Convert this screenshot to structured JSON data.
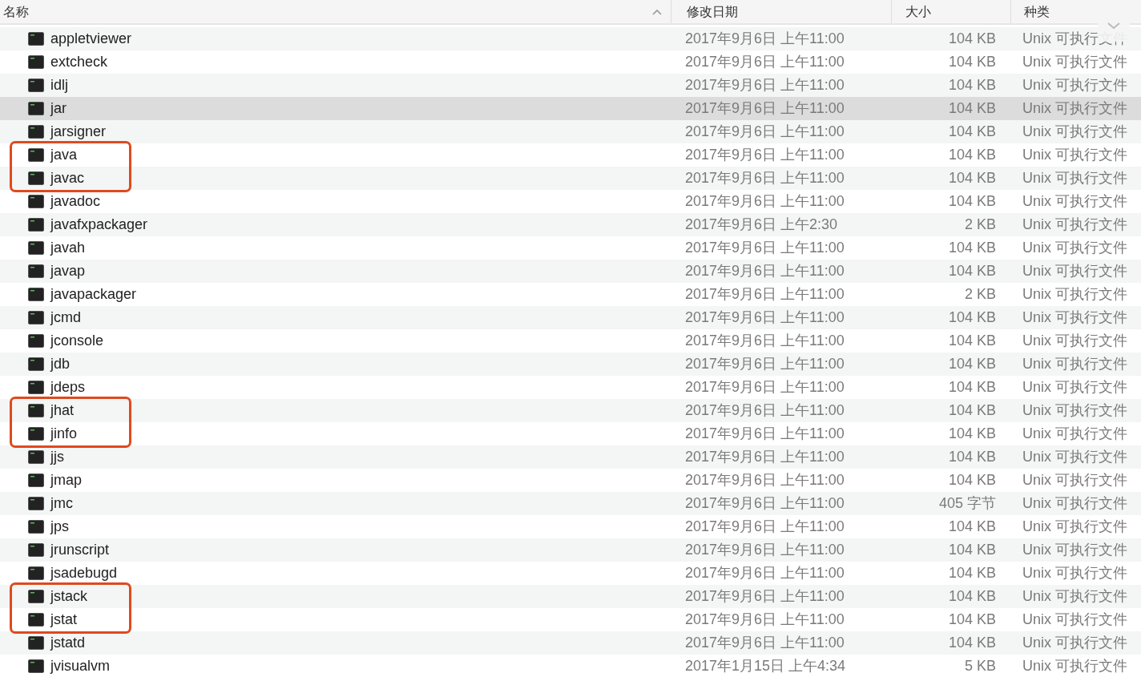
{
  "columns": [
    {
      "label": "名称",
      "sorted": true
    },
    {
      "label": "修改日期",
      "sorted": false
    },
    {
      "label": "大小",
      "sorted": false
    },
    {
      "label": "种类",
      "sorted": false
    }
  ],
  "rows": [
    {
      "name": "appletviewer",
      "date": "2017年9月6日 上午11:00",
      "size": "104 KB",
      "kind": "Unix 可执行文件",
      "selected": false,
      "circled": false
    },
    {
      "name": "extcheck",
      "date": "2017年9月6日 上午11:00",
      "size": "104 KB",
      "kind": "Unix 可执行文件",
      "selected": false,
      "circled": false
    },
    {
      "name": "idlj",
      "date": "2017年9月6日 上午11:00",
      "size": "104 KB",
      "kind": "Unix 可执行文件",
      "selected": false,
      "circled": false
    },
    {
      "name": "jar",
      "date": "2017年9月6日 上午11:00",
      "size": "104 KB",
      "kind": "Unix 可执行文件",
      "selected": true,
      "circled": false
    },
    {
      "name": "jarsigner",
      "date": "2017年9月6日 上午11:00",
      "size": "104 KB",
      "kind": "Unix 可执行文件",
      "selected": false,
      "circled": false
    },
    {
      "name": "java",
      "date": "2017年9月6日 上午11:00",
      "size": "104 KB",
      "kind": "Unix 可执行文件",
      "selected": false,
      "circled": true
    },
    {
      "name": "javac",
      "date": "2017年9月6日 上午11:00",
      "size": "104 KB",
      "kind": "Unix 可执行文件",
      "selected": false,
      "circled": true
    },
    {
      "name": "javadoc",
      "date": "2017年9月6日 上午11:00",
      "size": "104 KB",
      "kind": "Unix 可执行文件",
      "selected": false,
      "circled": false
    },
    {
      "name": "javafxpackager",
      "date": "2017年9月6日 上午2:30",
      "size": "2 KB",
      "kind": "Unix 可执行文件",
      "selected": false,
      "circled": false
    },
    {
      "name": "javah",
      "date": "2017年9月6日 上午11:00",
      "size": "104 KB",
      "kind": "Unix 可执行文件",
      "selected": false,
      "circled": false
    },
    {
      "name": "javap",
      "date": "2017年9月6日 上午11:00",
      "size": "104 KB",
      "kind": "Unix 可执行文件",
      "selected": false,
      "circled": false
    },
    {
      "name": "javapackager",
      "date": "2017年9月6日 上午11:00",
      "size": "2 KB",
      "kind": "Unix 可执行文件",
      "selected": false,
      "circled": false
    },
    {
      "name": "jcmd",
      "date": "2017年9月6日 上午11:00",
      "size": "104 KB",
      "kind": "Unix 可执行文件",
      "selected": false,
      "circled": false
    },
    {
      "name": "jconsole",
      "date": "2017年9月6日 上午11:00",
      "size": "104 KB",
      "kind": "Unix 可执行文件",
      "selected": false,
      "circled": false
    },
    {
      "name": "jdb",
      "date": "2017年9月6日 上午11:00",
      "size": "104 KB",
      "kind": "Unix 可执行文件",
      "selected": false,
      "circled": false
    },
    {
      "name": "jdeps",
      "date": "2017年9月6日 上午11:00",
      "size": "104 KB",
      "kind": "Unix 可执行文件",
      "selected": false,
      "circled": false
    },
    {
      "name": "jhat",
      "date": "2017年9月6日 上午11:00",
      "size": "104 KB",
      "kind": "Unix 可执行文件",
      "selected": false,
      "circled": true
    },
    {
      "name": "jinfo",
      "date": "2017年9月6日 上午11:00",
      "size": "104 KB",
      "kind": "Unix 可执行文件",
      "selected": false,
      "circled": true
    },
    {
      "name": "jjs",
      "date": "2017年9月6日 上午11:00",
      "size": "104 KB",
      "kind": "Unix 可执行文件",
      "selected": false,
      "circled": false
    },
    {
      "name": "jmap",
      "date": "2017年9月6日 上午11:00",
      "size": "104 KB",
      "kind": "Unix 可执行文件",
      "selected": false,
      "circled": false
    },
    {
      "name": "jmc",
      "date": "2017年9月6日 上午11:00",
      "size": "405 字节",
      "kind": "Unix 可执行文件",
      "selected": false,
      "circled": false
    },
    {
      "name": "jps",
      "date": "2017年9月6日 上午11:00",
      "size": "104 KB",
      "kind": "Unix 可执行文件",
      "selected": false,
      "circled": false
    },
    {
      "name": "jrunscript",
      "date": "2017年9月6日 上午11:00",
      "size": "104 KB",
      "kind": "Unix 可执行文件",
      "selected": false,
      "circled": false
    },
    {
      "name": "jsadebugd",
      "date": "2017年9月6日 上午11:00",
      "size": "104 KB",
      "kind": "Unix 可执行文件",
      "selected": false,
      "circled": false
    },
    {
      "name": "jstack",
      "date": "2017年9月6日 上午11:00",
      "size": "104 KB",
      "kind": "Unix 可执行文件",
      "selected": false,
      "circled": true
    },
    {
      "name": "jstat",
      "date": "2017年9月6日 上午11:00",
      "size": "104 KB",
      "kind": "Unix 可执行文件",
      "selected": false,
      "circled": true
    },
    {
      "name": "jstatd",
      "date": "2017年9月6日 上午11:00",
      "size": "104 KB",
      "kind": "Unix 可执行文件",
      "selected": false,
      "circled": false
    },
    {
      "name": "jvisualvm",
      "date": "2017年1月15日 上午4:34",
      "size": "5 KB",
      "kind": "Unix 可执行文件",
      "selected": false,
      "circled": false
    }
  ]
}
